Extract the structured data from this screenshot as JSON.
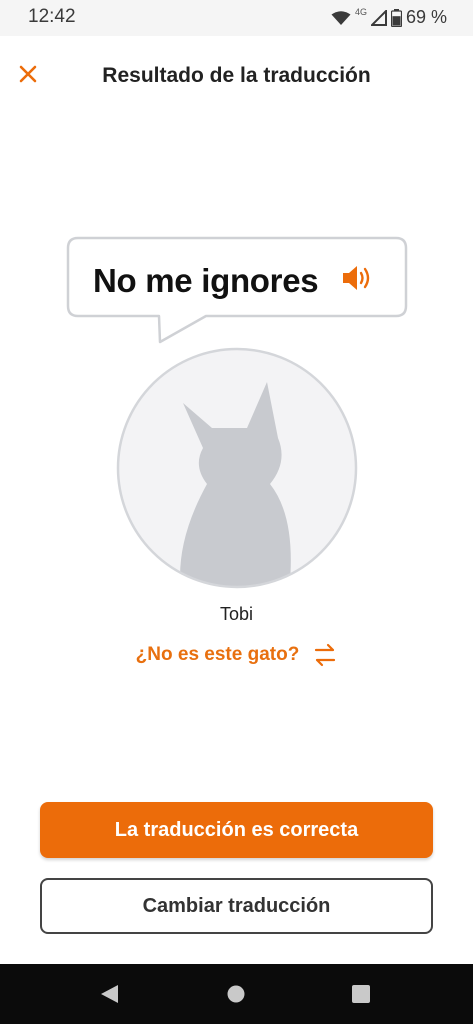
{
  "status_bar": {
    "time": "12:42",
    "network": "4G",
    "battery": "69 %",
    "battery_level": 0.69,
    "icons": [
      "wifi-icon",
      "cellular-signal-icon",
      "battery-icon"
    ]
  },
  "header": {
    "title": "Resultado de la traducción",
    "close_icon": "close-icon"
  },
  "translation": {
    "phrase": "No me ignores",
    "speaker_icon": "speaker-icon"
  },
  "cat": {
    "name": "Tobi",
    "avatar_icon": "cat-silhouette-icon"
  },
  "not_this_cat": {
    "label": "¿No es este gato?",
    "icon": "swap-arrows-icon"
  },
  "actions": {
    "confirm_label": "La traducción es correcta",
    "change_label": "Cambiar traducción"
  },
  "nav_bar": {
    "icons": [
      "back-icon",
      "home-icon",
      "recents-icon"
    ]
  },
  "colors": {
    "accent": "#ec6c0a",
    "text_dark": "#222222",
    "avatar_fill": "#f3f3f5",
    "silhouette": "#c8cacf",
    "nav_bg": "#0b0b0b"
  }
}
